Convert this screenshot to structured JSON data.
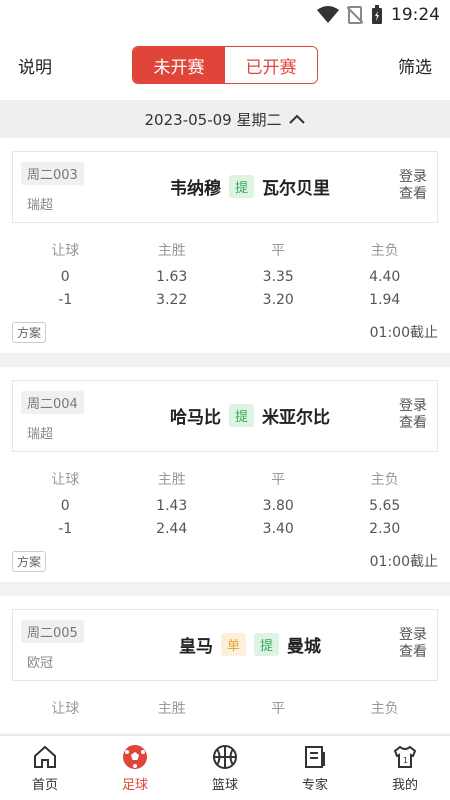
{
  "status": {
    "time": "19:24"
  },
  "header": {
    "left": "说明",
    "right": "筛选",
    "tabs": [
      "未开赛",
      "已开赛"
    ]
  },
  "date": "2023-05-09 星期二",
  "colors": {
    "accent": "#e0453a",
    "ti_green": "#39a85a",
    "dan_orange": "#e3a43a"
  },
  "odds_headers": [
    "让球",
    "主胜",
    "平",
    "主负"
  ],
  "matches": [
    {
      "code": "周二003",
      "league": "瑞超",
      "home": "韦纳穆",
      "away": "瓦尔贝里",
      "tags": [
        "提"
      ],
      "login": [
        "登录",
        "查看"
      ],
      "rows": [
        [
          "0",
          "1.63",
          "3.35",
          "4.40"
        ],
        [
          "-1",
          "3.22",
          "3.20",
          "1.94"
        ]
      ],
      "plan": "方案",
      "deadline": "01:00截止"
    },
    {
      "code": "周二004",
      "league": "瑞超",
      "home": "哈马比",
      "away": "米亚尔比",
      "tags": [
        "提"
      ],
      "login": [
        "登录",
        "查看"
      ],
      "rows": [
        [
          "0",
          "1.43",
          "3.80",
          "5.65"
        ],
        [
          "-1",
          "2.44",
          "3.40",
          "2.30"
        ]
      ],
      "plan": "方案",
      "deadline": "01:00截止"
    },
    {
      "code": "周二005",
      "league": "欧冠",
      "home": "皇马",
      "away": "曼城",
      "tags": [
        "单",
        "提"
      ],
      "login": [
        "登录",
        "查看"
      ],
      "rows": [],
      "plan": "",
      "deadline": ""
    }
  ],
  "tabbar": [
    {
      "label": "首页",
      "icon": "home-icon"
    },
    {
      "label": "足球",
      "icon": "football-icon"
    },
    {
      "label": "篮球",
      "icon": "basketball-icon"
    },
    {
      "label": "专家",
      "icon": "expert-icon"
    },
    {
      "label": "我的",
      "icon": "jersey-icon"
    }
  ]
}
